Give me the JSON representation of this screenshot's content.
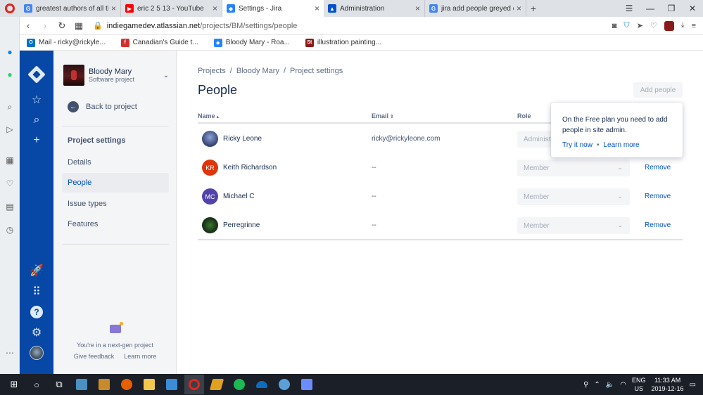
{
  "browser": {
    "tabs": [
      {
        "title": "greatest authors of all time",
        "fav": "G",
        "color": "#4285f4",
        "active": false
      },
      {
        "title": "eric 2 5 13 - YouTube",
        "fav": "▶",
        "color": "#ff0000",
        "active": false
      },
      {
        "title": "Settings - Jira",
        "fav": "◆",
        "color": "#2684ff",
        "active": true
      },
      {
        "title": "Administration",
        "fav": "▲",
        "color": "#0052cc",
        "active": false
      },
      {
        "title": "jira add people greyed out",
        "fav": "G",
        "color": "#4285f4",
        "active": false
      }
    ],
    "url_host": "indiegamedev.atlassian.net",
    "url_path": "/projects/BM/settings/people",
    "bookmarks": [
      {
        "label": "Mail - ricky@rickyle...",
        "icon": "O",
        "color": "#0072c6"
      },
      {
        "label": "Canadian's Guide t...",
        "icon": "f",
        "color": "#d32f2f"
      },
      {
        "label": "Bloody Mary - Roa...",
        "icon": "◆",
        "color": "#2684ff"
      },
      {
        "label": "illustration painting...",
        "icon": "St",
        "color": "#8b1a1a"
      }
    ]
  },
  "project": {
    "name": "Bloody Mary",
    "type": "Software project",
    "back_label": "Back to project",
    "section_title": "Project settings",
    "nav_items": [
      "Details",
      "People",
      "Issue types",
      "Features"
    ],
    "selected": "People",
    "footer_text": "You're in a next-gen project",
    "footer_link1": "Give feedback",
    "footer_link2": "Learn more"
  },
  "main": {
    "breadcrumbs": [
      "Projects",
      "Bloody Mary",
      "Project settings"
    ],
    "title": "People",
    "add_button": "Add people",
    "columns": {
      "name": "Name",
      "email": "Email",
      "role": "Role"
    },
    "rows": [
      {
        "name": "Ricky Leone",
        "email": "ricky@rickyleone.com",
        "role": "Administ",
        "remove": "",
        "avatar_initials": "",
        "avatar_color": "#3f4f7f"
      },
      {
        "name": "Keith Richardson",
        "email": "--",
        "role": "Member",
        "remove": "Remove",
        "avatar_initials": "KR",
        "avatar_color": "#de350b"
      },
      {
        "name": "Michael C",
        "email": "--",
        "role": "Member",
        "remove": "Remove",
        "avatar_initials": "MC",
        "avatar_color": "#5243aa"
      },
      {
        "name": "Perregrinne",
        "email": "--",
        "role": "Member",
        "remove": "Remove",
        "avatar_initials": "",
        "avatar_color": "#1e3d1e"
      }
    ],
    "popup": {
      "text": "On the Free plan you need to add people in site admin.",
      "link1": "Try it now",
      "link2": "Learn more"
    }
  },
  "taskbar": {
    "lang1": "ENG",
    "lang2": "US",
    "time": "11:33 AM",
    "date": "2019-12-16"
  }
}
